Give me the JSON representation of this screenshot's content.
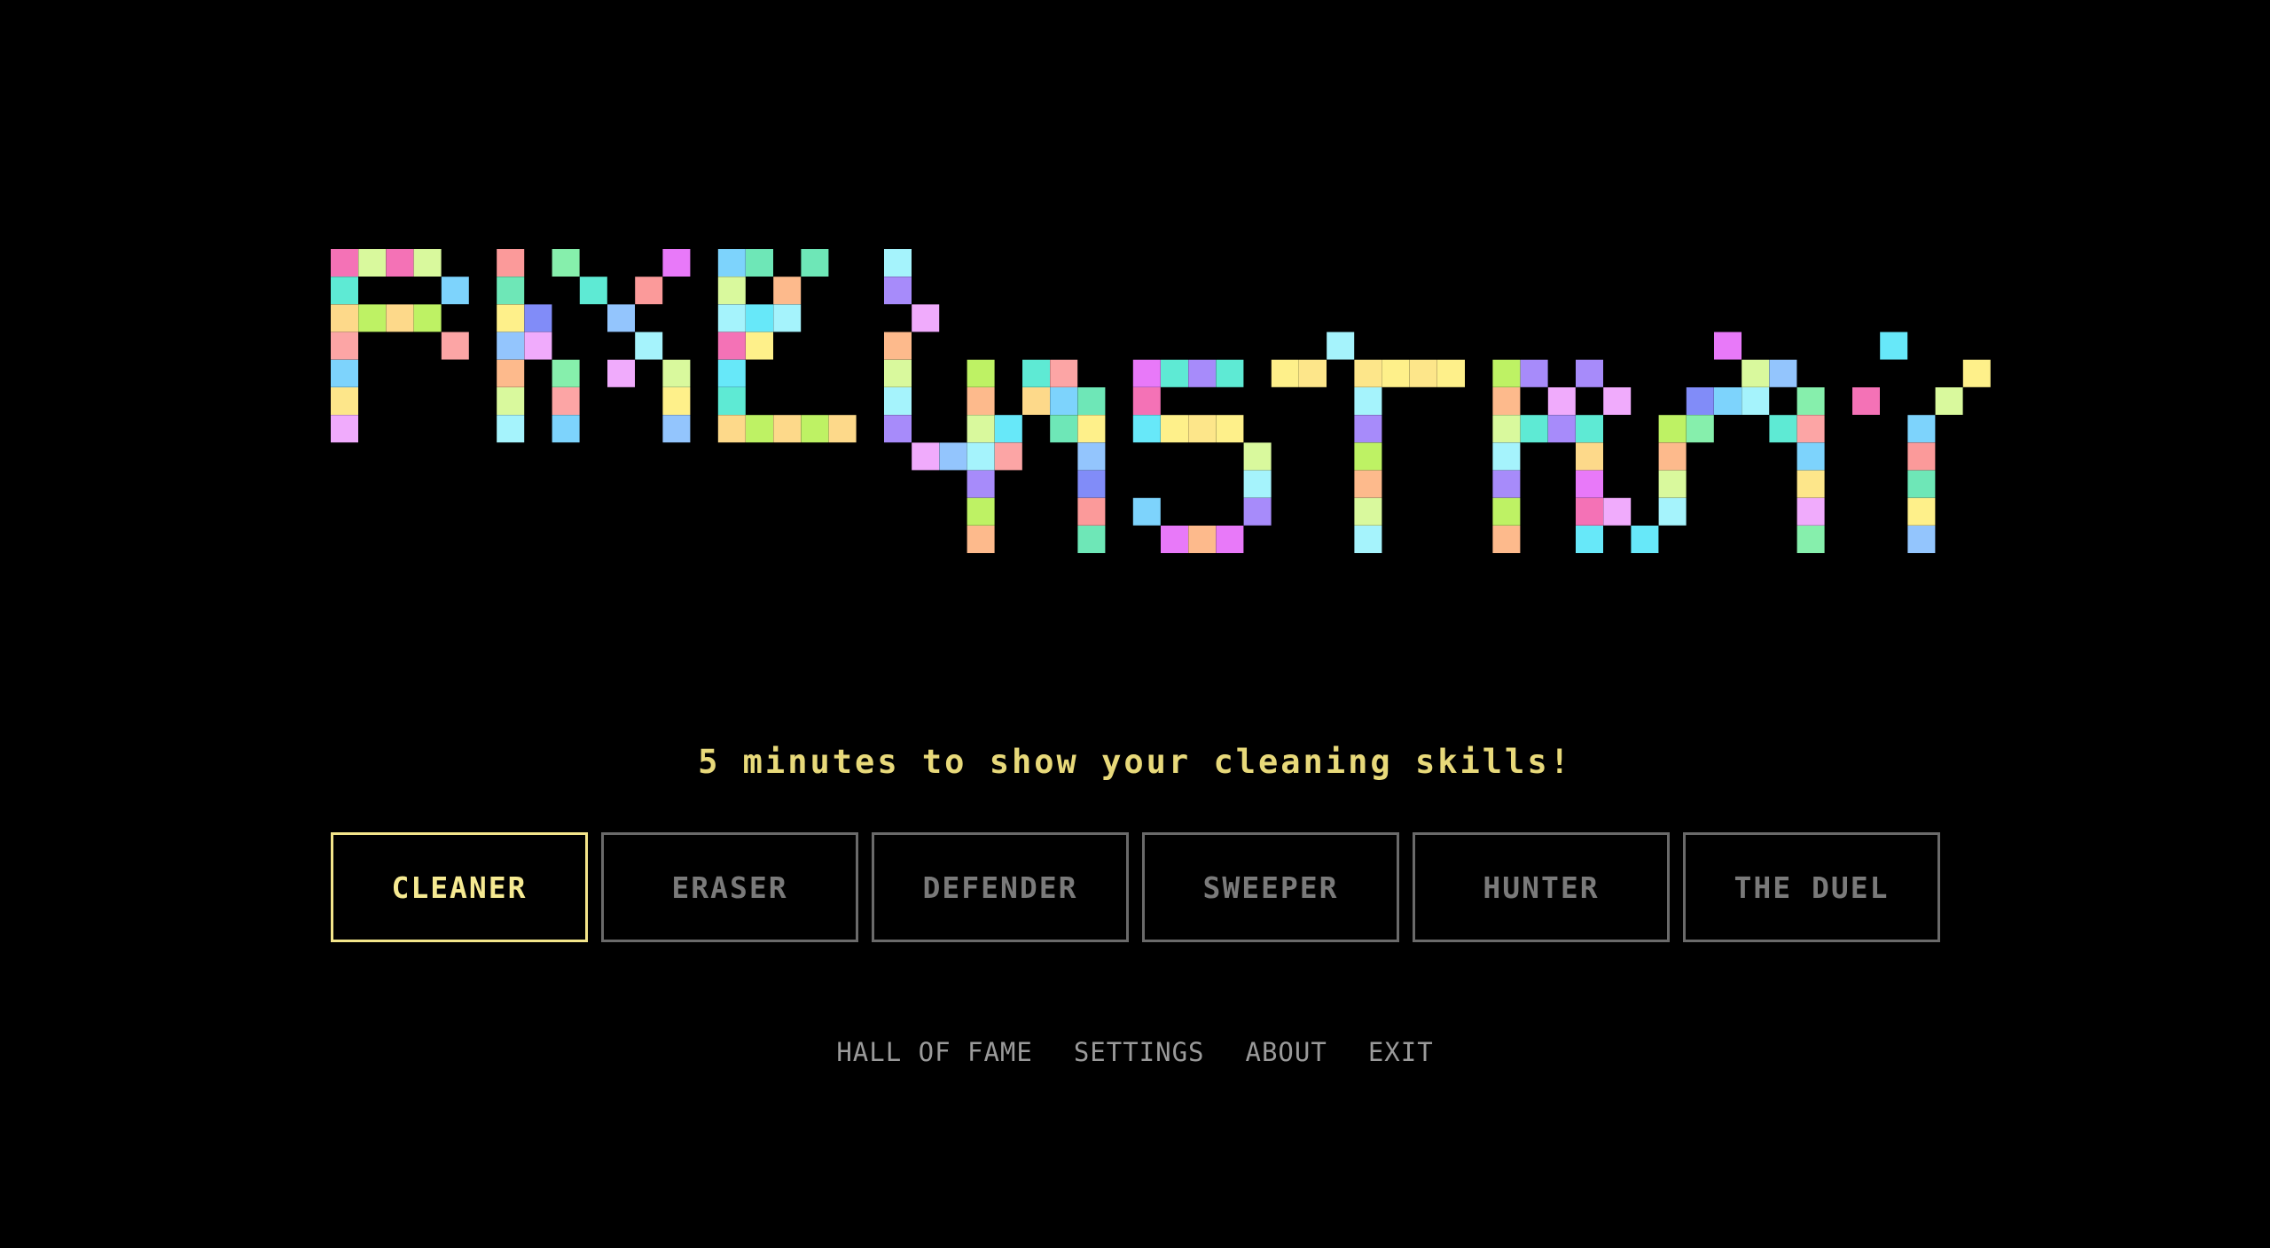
{
  "logo": {
    "palette": [
      "#f472b6",
      "#7dd3fc",
      "#fdba8c",
      "#fb9a9a",
      "#fdd98a",
      "#86efac",
      "#a78bfa",
      "#93c5fd",
      "#67e8f9",
      "#fde68a",
      "#d9f99d",
      "#6ee7b7",
      "#e879f9",
      "#fca5a5",
      "#bef264",
      "#818cf8",
      "#5eead4",
      "#f0abfc",
      "#a5f3fc",
      "#fef08a"
    ]
  },
  "tagline": "5 minutes to show your cleaning skills!",
  "modes": [
    {
      "label": "CLEANER",
      "selected": true
    },
    {
      "label": "ERASER",
      "selected": false
    },
    {
      "label": "DEFENDER",
      "selected": false
    },
    {
      "label": "SWEEPER",
      "selected": false
    },
    {
      "label": "HUNTER",
      "selected": false
    },
    {
      "label": "THE DUEL",
      "selected": false
    }
  ],
  "footer": {
    "hall_of_fame": "HALL OF FAME",
    "settings": "SETTINGS",
    "about": "ABOUT",
    "exit": "EXIT"
  },
  "colors": {
    "background": "#000000",
    "accent": "#f3e58a",
    "inactive": "#6a6a6a"
  }
}
